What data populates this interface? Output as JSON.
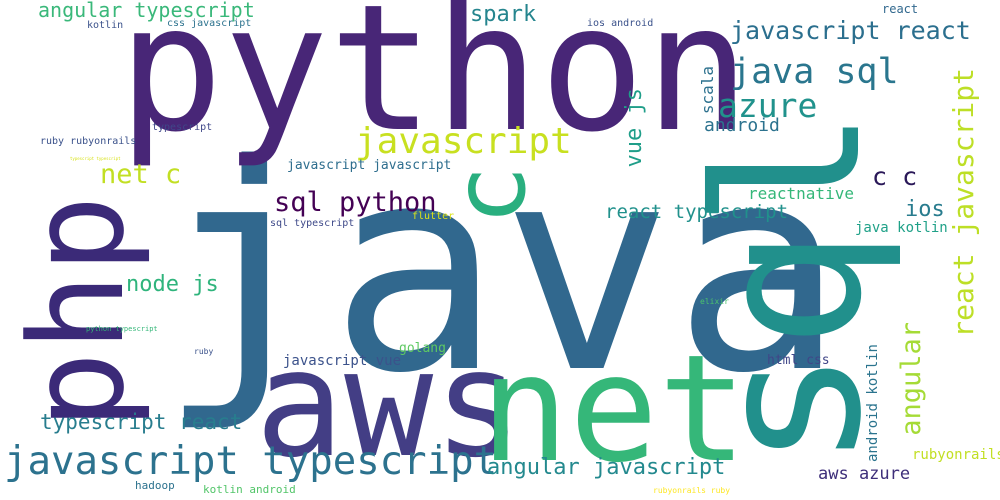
{
  "words": [
    {
      "text": "java",
      "color": "#31688e"
    },
    {
      "text": "python",
      "color": "#482677"
    },
    {
      "text": "sql",
      "color": "#21908c"
    },
    {
      "text": "aws",
      "color": "#433e85"
    },
    {
      "text": "net",
      "color": "#35b779"
    },
    {
      "text": "php",
      "color": "#3b2a78"
    },
    {
      "text": "c",
      "color": "#29af7f"
    },
    {
      "text": "javascript typescript",
      "color": "#2c728e"
    },
    {
      "text": "javascript",
      "color": "#c8e020"
    },
    {
      "text": "java sql",
      "color": "#2a768e"
    },
    {
      "text": "azure",
      "color": "#20928c"
    },
    {
      "text": "javascript react",
      "color": "#2b6f8e"
    },
    {
      "text": "angular typescript",
      "color": "#3ab87a"
    },
    {
      "text": "sql python",
      "color": "#440154"
    },
    {
      "text": "net c",
      "color": "#c2df23"
    },
    {
      "text": "react javascript",
      "color": "#bddf26"
    },
    {
      "text": "angular",
      "color": "#a5db36"
    },
    {
      "text": "spark",
      "color": "#25858e"
    },
    {
      "text": "vue js",
      "color": "#1f9e89"
    },
    {
      "text": "android",
      "color": "#2c728e"
    },
    {
      "text": "scala",
      "color": "#2d718e"
    },
    {
      "text": "c c",
      "color": "#2a1858"
    },
    {
      "text": "react typescript",
      "color": "#21918c"
    },
    {
      "text": "ios",
      "color": "#287c8e"
    },
    {
      "text": "node js",
      "color": "#2fb47c"
    },
    {
      "text": "typescript react",
      "color": "#287d8e"
    },
    {
      "text": "angular javascript",
      "color": "#23898e"
    },
    {
      "text": "aws azure",
      "color": "#3e2f7a"
    },
    {
      "text": "reactnative",
      "color": "#35b779"
    },
    {
      "text": "java kotlin",
      "color": "#1fa188"
    },
    {
      "text": "javascript javascript",
      "color": "#2e6e8e"
    },
    {
      "text": "javascript vue",
      "color": "#3b528b"
    },
    {
      "text": "html css",
      "color": "#404688"
    },
    {
      "text": "android kotlin",
      "color": "#2b748e"
    },
    {
      "text": "rubyonrails",
      "color": "#c2df23"
    },
    {
      "text": "golang",
      "color": "#5ec962"
    },
    {
      "text": "hadoop",
      "color": "#2c728e"
    },
    {
      "text": "kotlin android",
      "color": "#52c569"
    },
    {
      "text": "react",
      "color": "#31688e"
    },
    {
      "text": "ios android",
      "color": "#3b528b"
    },
    {
      "text": "kotlin",
      "color": "#3b528b"
    },
    {
      "text": "css javascript",
      "color": "#2c728e"
    },
    {
      "text": "typescript",
      "color": "#3f4788"
    },
    {
      "text": "ruby rubyonrails",
      "color": "#3b528b"
    },
    {
      "text": "sql typescript",
      "color": "#3e4989"
    },
    {
      "text": "flutter",
      "color": "#dde318"
    },
    {
      "text": "elixir",
      "color": "#4ac16d"
    },
    {
      "text": "python typescript",
      "color": "#35b779"
    },
    {
      "text": "ruby",
      "color": "#3b528b"
    },
    {
      "text": "rubyonrails ruby",
      "color": "#fde725"
    },
    {
      "text": "typescript typescript",
      "color": "#d8e219"
    }
  ]
}
